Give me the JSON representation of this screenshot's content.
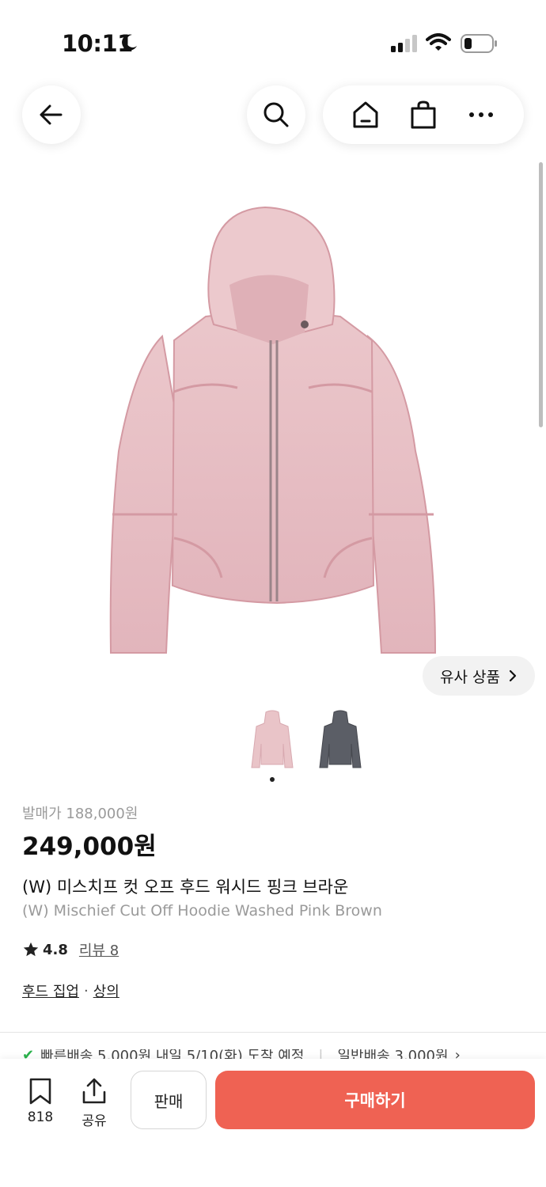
{
  "status_bar": {
    "time": "10:11"
  },
  "similar_button": {
    "label": "유사 상품"
  },
  "product": {
    "retail_price": "발매가 188,000원",
    "price": "249,000원",
    "name_ko": "(W) 미스치프 컷 오프 후드 워시드 핑크 브라운",
    "name_en": "(W) Mischief Cut Off Hoodie Washed Pink Brown",
    "rating": "4.8",
    "reviews": "리뷰 8",
    "category_1": "후드 집업",
    "category_sep": "·",
    "category_2": "상의",
    "colors": {
      "pink": "#e9c4c8",
      "charcoal": "#5b5e66"
    }
  },
  "shipping": {
    "fast": "빠른배송 5,000원 내일 5/10(화) 도착 예정",
    "normal": "일반배송 3,000원"
  },
  "bottom_bar": {
    "bookmark_count": "818",
    "share_label": "공유",
    "sell_label": "판매",
    "buy_label": "구매하기"
  },
  "theme": {
    "accent": "#ef6253"
  }
}
